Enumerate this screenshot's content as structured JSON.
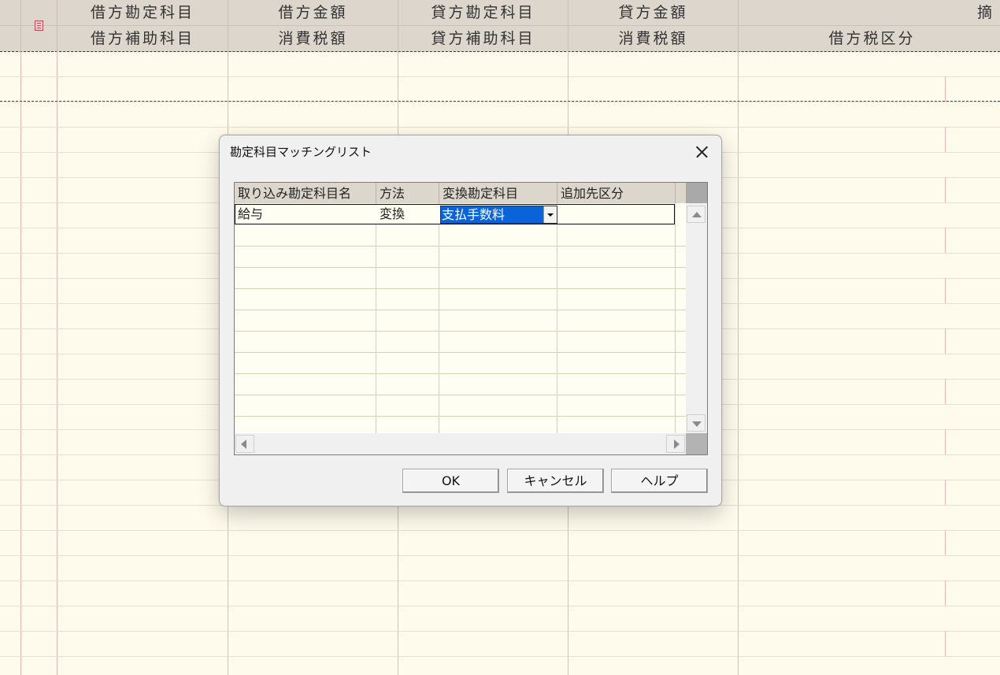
{
  "ledger": {
    "header_row1": [
      "借方勘定科目",
      "借方金額",
      "貸方勘定科目",
      "貸方金額",
      "摘"
    ],
    "header_row2": [
      "借方補助科目",
      "消費税額",
      "貸方補助科目",
      "消費税額",
      "借方税区分"
    ],
    "row_icon": "book-icon"
  },
  "dialog": {
    "title": "勘定科目マッチングリスト",
    "close_icon": "close-icon",
    "grid": {
      "columns": [
        "取り込み勘定科目名",
        "方法",
        "変換勘定科目",
        "追加先区分"
      ],
      "rows": [
        {
          "source_account": "給与",
          "method": "変換",
          "target_account": "支払手数料",
          "destination_category": ""
        }
      ]
    },
    "buttons": {
      "ok": "OK",
      "cancel": "キャンセル",
      "help": "ヘルプ"
    }
  },
  "colors": {
    "ledger_background": "#fefbec",
    "header_background": "#ddd6cc",
    "red_gridline": "#e3b5b5",
    "selection": "#0a64d8",
    "dialog_background": "#f0f0f0"
  }
}
